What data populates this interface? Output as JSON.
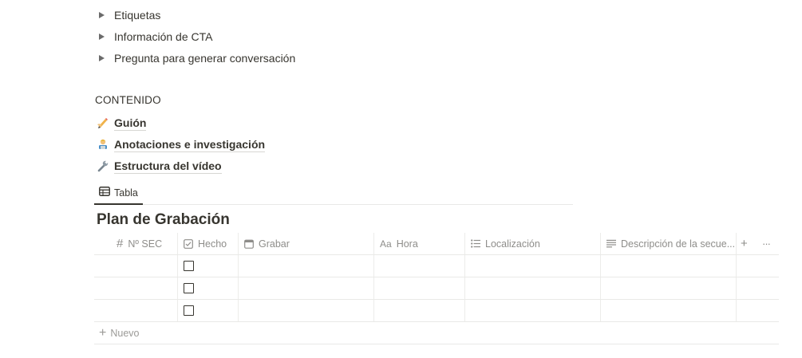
{
  "toggles": [
    "Etiquetas",
    "Información de CTA",
    "Pregunta para generar conversación"
  ],
  "section_title": "CONTENIDO",
  "pages": [
    {
      "icon": "writing-hand-emoji",
      "label": "Guión"
    },
    {
      "icon": "technologist-emoji",
      "label": "Anotaciones e investigación"
    },
    {
      "icon": "wrench-emoji",
      "label": "Estructura del vídeo"
    }
  ],
  "view_tab": {
    "icon": "table-icon",
    "label": "Tabla"
  },
  "database_title": "Plan de Grabación",
  "columns": [
    {
      "icon": "hash-icon",
      "icon_text": "#",
      "label": "Nº SEC"
    },
    {
      "icon": "checkbox-icon",
      "label": "Hecho"
    },
    {
      "icon": "calendar-icon",
      "label": "Grabar"
    },
    {
      "icon": "title-icon",
      "icon_text": "Aa",
      "label": "Hora"
    },
    {
      "icon": "list-icon",
      "label": "Localización"
    },
    {
      "icon": "text-icon",
      "label": "Descripción de la secue..."
    }
  ],
  "header_actions": {
    "add": "+",
    "more": "···"
  },
  "rows": [
    {
      "sec": "",
      "hecho": false
    },
    {
      "sec": "",
      "hecho": false
    },
    {
      "sec": "",
      "hecho": false
    }
  ],
  "new_row": {
    "plus": "+",
    "label": "Nuevo"
  }
}
